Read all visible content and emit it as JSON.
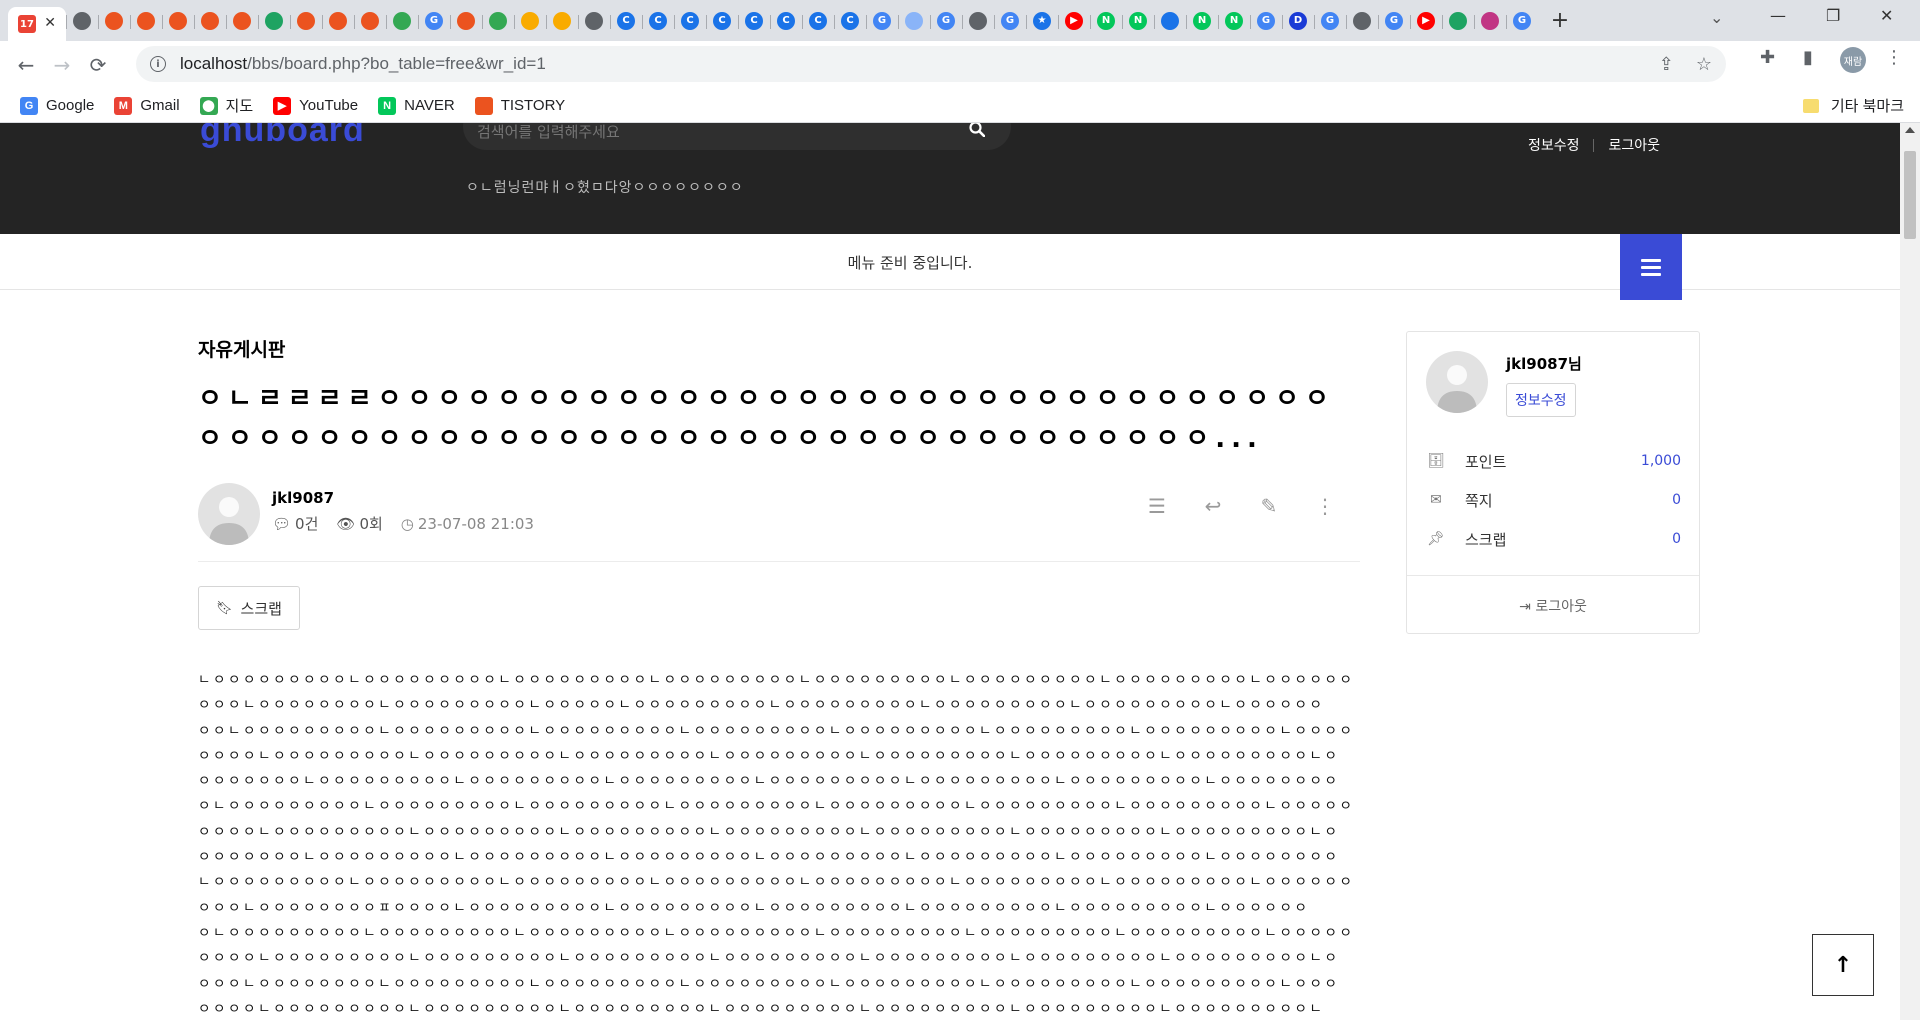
{
  "browser": {
    "tabs": [
      {
        "icon": "calendar-icon",
        "color": "#ea4335",
        "glyph": "17"
      },
      {
        "icon": "globe-icon",
        "color": "#5f6368",
        "glyph": ""
      },
      {
        "icon": "tistory-icon",
        "color": "#eb531f",
        "glyph": ""
      },
      {
        "icon": "tistory-icon",
        "color": "#eb531f",
        "glyph": ""
      },
      {
        "icon": "tistory-icon",
        "color": "#eb531f",
        "glyph": ""
      },
      {
        "icon": "tistory-icon",
        "color": "#eb531f",
        "glyph": ""
      },
      {
        "icon": "tistory-icon",
        "color": "#eb531f",
        "glyph": ""
      },
      {
        "icon": "green-doc-icon",
        "color": "#1ea362",
        "glyph": ""
      },
      {
        "icon": "tistory-icon",
        "color": "#eb531f",
        "glyph": ""
      },
      {
        "icon": "tistory-icon",
        "color": "#eb531f",
        "glyph": ""
      },
      {
        "icon": "tistory-icon",
        "color": "#eb531f",
        "glyph": ""
      },
      {
        "icon": "sheets-icon",
        "color": "#34a853",
        "glyph": ""
      },
      {
        "icon": "google-icon",
        "color": "#4285f4",
        "glyph": "G"
      },
      {
        "icon": "tistory-icon",
        "color": "#eb531f",
        "glyph": ""
      },
      {
        "icon": "monitor-icon",
        "color": "#34a853",
        "glyph": ""
      },
      {
        "icon": "analytics-icon",
        "color": "#f9ab00",
        "glyph": ""
      },
      {
        "icon": "analytics-icon",
        "color": "#f9ab00",
        "glyph": ""
      },
      {
        "icon": "wifi-icon",
        "color": "#5f6368",
        "glyph": ""
      },
      {
        "icon": "c-icon",
        "color": "#1a73e8",
        "glyph": "C"
      },
      {
        "icon": "c-icon",
        "color": "#1a73e8",
        "glyph": "C"
      },
      {
        "icon": "c-icon",
        "color": "#1a73e8",
        "glyph": "C"
      },
      {
        "icon": "c-icon",
        "color": "#1a73e8",
        "glyph": "C"
      },
      {
        "icon": "c-icon",
        "color": "#1a73e8",
        "glyph": "C"
      },
      {
        "icon": "c-icon",
        "color": "#1a73e8",
        "glyph": "C"
      },
      {
        "icon": "c-icon",
        "color": "#1a73e8",
        "glyph": "C"
      },
      {
        "icon": "c-icon",
        "color": "#1a73e8",
        "glyph": "C"
      },
      {
        "icon": "google-icon",
        "color": "#4285f4",
        "glyph": "G"
      },
      {
        "icon": "cloud-icon",
        "color": "#8ab4f8",
        "glyph": ""
      },
      {
        "icon": "google-icon",
        "color": "#4285f4",
        "glyph": "G"
      },
      {
        "icon": "globe-icon",
        "color": "#5f6368",
        "glyph": ""
      },
      {
        "icon": "google-icon",
        "color": "#4285f4",
        "glyph": "G"
      },
      {
        "icon": "star-icon",
        "color": "#1a73e8",
        "glyph": "★"
      },
      {
        "icon": "youtube-icon",
        "color": "#ff0000",
        "glyph": "▶"
      },
      {
        "icon": "naver-icon",
        "color": "#03c75a",
        "glyph": "N"
      },
      {
        "icon": "naver-icon",
        "color": "#03c75a",
        "glyph": "N"
      },
      {
        "icon": "cube-icon",
        "color": "#1a73e8",
        "glyph": ""
      },
      {
        "icon": "naver-icon",
        "color": "#03c75a",
        "glyph": "N"
      },
      {
        "icon": "naver-icon",
        "color": "#03c75a",
        "glyph": "N"
      },
      {
        "icon": "google-icon",
        "color": "#4285f4",
        "glyph": "G"
      },
      {
        "icon": "d-icon",
        "color": "#1a3bd6",
        "glyph": "D"
      },
      {
        "icon": "google-icon",
        "color": "#4285f4",
        "glyph": "G"
      },
      {
        "icon": "globe-icon",
        "color": "#5f6368",
        "glyph": ""
      },
      {
        "icon": "google-icon",
        "color": "#4285f4",
        "glyph": "G"
      },
      {
        "icon": "youtube-icon",
        "color": "#ff0000",
        "glyph": "▶"
      },
      {
        "icon": "green-doc-icon",
        "color": "#1ea362",
        "glyph": ""
      },
      {
        "icon": "instagram-icon",
        "color": "#c13584",
        "glyph": ""
      },
      {
        "icon": "google-icon",
        "color": "#4285f4",
        "glyph": "G"
      }
    ],
    "active_tab_icon": "calendar-icon",
    "url_host": "localhost",
    "url_path": "/bbs/board.php?bo_table=free&wr_id=1",
    "profile_label": "재람",
    "bookmarks": [
      {
        "label": "Google",
        "icon": "google-icon",
        "color": "#4285f4",
        "glyph": "G"
      },
      {
        "label": "Gmail",
        "icon": "gmail-icon",
        "color": "#ea4335",
        "glyph": "M"
      },
      {
        "label": "지도",
        "icon": "maps-icon",
        "color": "#34a853",
        "glyph": "⬤"
      },
      {
        "label": "YouTube",
        "icon": "youtube-icon",
        "color": "#ff0000",
        "glyph": "▶"
      },
      {
        "label": "NAVER",
        "icon": "naver-icon",
        "color": "#03c75a",
        "glyph": "N"
      },
      {
        "label": "TISTORY",
        "icon": "tistory-icon",
        "color": "#eb531f",
        "glyph": ""
      }
    ],
    "other_bookmarks": "기타 북마크"
  },
  "site": {
    "search_placeholder": "검색어를 입력해주세요",
    "popular": "ㅇㄴ럼닝런먀ㅐㅇ혔ㅁ다앙ㅇㅇㅇㅇㅇㅇㅇㅇ",
    "top_links": [
      "정보수정",
      "로그아웃"
    ],
    "gnb_empty": "메뉴 준비 중입니다.",
    "accent": "#3a4bd6"
  },
  "post": {
    "board_title": "자유게시판",
    "title": "ㅇㄴㄹㄹㄹㄹㅇㅇㅇㅇㅇㅇㅇㅇㅇㅇㅇㅇㅇㅇㅇㅇㅇㅇㅇㅇㅇㅇㅇㅇㅇㅇㅇㅇㅇㅇㅇㅇㅇㅇㅇㅇㅇㅇㅇㅇㅇㅇㅇㅇㅇㅇㅇㅇㅇㅇㅇㅇㅇㅇㅇㅇㅇㅇㅇㅇㅇㅇㅇㅇㅇㅇ...",
    "author": "jkl9087",
    "comments": "0건",
    "views": "0회",
    "date": "23-07-08 21:03",
    "scrap_label": "스크랩",
    "body_lines": [
      "ㄴㅇㅇㅇㅇㅇㅇㅇㅇㅇㄴㅇㅇㅇㅇㅇㅇㅇㅇㅇㄴㅇㅇㅇㅇㅇㅇㅇㅇㅇㄴㅇㅇㅇㅇㅇㅇㅇㅇㅇㄴㅇㅇㅇㅇㅇㅇㅇㅇㅇㄴㅇㅇㅇㅇㅇㅇㅇㅇㅇㄴㅇㅇㅇㅇㅇㅇㅇㅇㅇㄴㅇㅇㅇㅇㅇㅇ",
      "ㅇㅇㅇㄴㅇㅇㅇㅇㅇㅇㅇㅇㄴㅇㅇㅇㅇㅇㅇㅇㅇㅇㄴㅇㅇㅇㅇㅇㄴㅇㅇㅇㅇㅇㅇㅇㅇㅇㄴㅇㅇㅇㅇㅇㅇㅇㅇㅇㄴㅇㅇㅇㅇㅇㅇㅇㅇㅇㄴㅇㅇㅇㅇㅇㅇㅇㅇㅇㄴㅇㅇㅇㅇㅇㅇ",
      "ㅇㅇㄴㅇㅇㅇㅇㅇㅇㅇㅇㅇㄴㅇㅇㅇㅇㅇㅇㅇㅇㅇㄴㅇㅇㅇㅇㅇㅇㅇㅇㅇㄴㅇㅇㅇㅇㅇㅇㅇㅇㅇㄴㅇㅇㅇㅇㅇㅇㅇㅇㅇㄴㅇㅇㅇㅇㅇㅇㅇㅇㅇㄴㅇㅇㅇㅇㅇㅇㅇㅇㅇㄴㅇㅇㅇㅇ",
      "ㅇㅇㅇㅇㄴㅇㅇㅇㅇㅇㅇㅇㅇㅇㄴㅇㅇㅇㅇㅇㅇㅇㅇㅇㄴㅇㅇㅇㅇㅇㅇㅇㅇㅇㄴㅇㅇㅇㅇㅇㅇㅇㅇㅇㄴㅇㅇㅇㅇㅇㅇㅇㅇㅇㄴㅇㅇㅇㅇㅇㅇㅇㅇㅇㄴㅇㅇㅇㅇㅇㅇㅇㅇㅇㄴㅇ",
      "ㅇㅇㅇㅇㅇㅇㅇㄴㅇㅇㅇㅇㅇㅇㅇㅇㅇㄴㅇㅇㅇㅇㅇㅇㅇㅇㅇㄴㅇㅇㅇㅇㅇㅇㅇㅇㅇㄴㅇㅇㅇㅇㅇㅇㅇㅇㅇㄴㅇㅇㅇㅇㅇㅇㅇㅇㅇㄴㅇㅇㅇㅇㅇㅇㅇㅇㅇㄴㅇㅇㅇㅇㅇㅇㅇㅇ",
      "ㅇㄴㅇㅇㅇㅇㅇㅇㅇㅇㅇㄴㅇㅇㅇㅇㅇㅇㅇㅇㅇㄴㅇㅇㅇㅇㅇㅇㅇㅇㅇㄴㅇㅇㅇㅇㅇㅇㅇㅇㅇㄴㅇㅇㅇㅇㅇㅇㅇㅇㅇㄴㅇㅇㅇㅇㅇㅇㅇㅇㅇㄴㅇㅇㅇㅇㅇㅇㅇㅇㅇㄴㅇㅇㅇㅇㅇ",
      "ㅇㅇㅇㅇㄴㅇㅇㅇㅇㅇㅇㅇㅇㅇㄴㅇㅇㅇㅇㅇㅇㅇㅇㅇㄴㅇㅇㅇㅇㅇㅇㅇㅇㅇㄴㅇㅇㅇㅇㅇㅇㅇㅇㅇㄴㅇㅇㅇㅇㅇㅇㅇㅇㅇㄴㅇㅇㅇㅇㅇㅇㅇㅇㅇㄴㅇㅇㅇㅇㅇㅇㅇㅇㅇㄴㅇ",
      "ㅇㅇㅇㅇㅇㅇㅇㄴㅇㅇㅇㅇㅇㅇㅇㅇㅇㄴㅇㅇㅇㅇㅇㅇㅇㅇㅇㄴㅇㅇㅇㅇㅇㅇㅇㅇㅇㄴㅇㅇㅇㅇㅇㅇㅇㅇㅇㄴㅇㅇㅇㅇㅇㅇㅇㅇㅇㄴㅇㅇㅇㅇㅇㅇㅇㅇㅇㄴㅇㅇㅇㅇㅇㅇㅇㅇ",
      "ㄴㅇㅇㅇㅇㅇㅇㅇㅇㅇㄴㅇㅇㅇㅇㅇㅇㅇㅇㅇㄴㅇㅇㅇㅇㅇㅇㅇㅇㅇㄴㅇㅇㅇㅇㅇㅇㅇㅇㅇㄴㅇㅇㅇㅇㅇㅇㅇㅇㅇㄴㅇㅇㅇㅇㅇㅇㅇㅇㅇㄴㅇㅇㅇㅇㅇㅇㅇㅇㅇㄴㅇㅇㅇㅇㅇㅇ",
      "ㅇㅇㅇㄴㅇㅇㅇㅇㅇㅇㅇㅇㅍㅇㅇㅇㅇㄴㅇㅇㅇㅇㅇㅇㅇㅇㅇㄴㅇㅇㅇㅇㅇㅇㅇㅇㅇㄴㅇㅇㅇㅇㅇㅇㅇㅇㅇㄴㅇㅇㅇㅇㅇㅇㅇㅇㅇㄴㅇㅇㅇㅇㅇㅇㅇㅇㅇㄴㅇㅇㅇㅇㅇㅇ",
      "ㅇㄴㅇㅇㅇㅇㅇㅇㅇㅇㅇㄴㅇㅇㅇㅇㅇㅇㅇㅇㅇㄴㅇㅇㅇㅇㅇㅇㅇㅇㅇㄴㅇㅇㅇㅇㅇㅇㅇㅇㅇㄴㅇㅇㅇㅇㅇㅇㅇㅇㅇㄴㅇㅇㅇㅇㅇㅇㅇㅇㅇㄴㅇㅇㅇㅇㅇㅇㅇㅇㅇㄴㅇㅇㅇㅇㅇ",
      "ㅇㅇㅇㅇㄴㅇㅇㅇㅇㅇㅇㅇㅇㅇㄴㅇㅇㅇㅇㅇㅇㅇㅇㅇㄴㅇㅇㅇㅇㅇㅇㅇㅇㅇㄴㅇㅇㅇㅇㅇㅇㅇㅇㅇㄴㅇㅇㅇㅇㅇㅇㅇㅇㅇㄴㅇㅇㅇㅇㅇㅇㅇㅇㅇㄴㅇㅇㅇㅇㅇㅇㅇㅇㅇㄴㅇ",
      "ㅇㅇㅇㄴㅇㅇㅇㅇㅇㅇㅇㅇㄴㅇㅇㅇㅇㅇㅇㅇㅇㅇㄴㅇㅇㅇㅇㅇㅇㅇㅇㅇㄴㅇㅇㅇㅇㅇㅇㅇㅇㅇㄴㅇㅇㅇㅇㅇㅇㅇㅇㅇㄴㅇㅇㅇㅇㅇㅇㅇㅇㅇㄴㅇㅇㅇㅇㅇㅇㅇㅇㅇㄴㅇㅇㅇ",
      "ㅇㅇㅇㅇㄴㅇㅇㅇㅇㅇㅇㅇㅇㅇㄴㅇㅇㅇㅇㅇㅇㅇㅇㅇㄴㅇㅇㅇㅇㅇㅇㅇㅇㅇㄴㅇㅇㅇㅇㅇㅇㅇㅇㅇㄴㅇㅇㅇㅇㅇㅇㅇㅇㅇㄴㅇㅇㅇㅇㅇㅇㅇㅇㅇㄴㅇㅇㅇㅇㅇㅇㅇㅇㅇㄴ"
    ]
  },
  "sidebar": {
    "user": "jkl9087님",
    "edit_label": "정보수정",
    "rows": [
      {
        "icon": "database-icon",
        "label": "포인트",
        "value": "1,000"
      },
      {
        "icon": "envelope-icon",
        "label": "쪽지",
        "value": "0"
      },
      {
        "icon": "pin-icon",
        "label": "스크랩",
        "value": "0"
      }
    ],
    "logout": "로그아웃"
  }
}
